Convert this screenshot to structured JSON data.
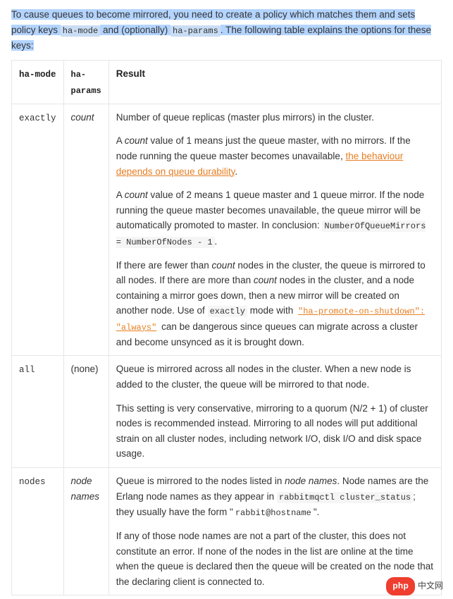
{
  "intro": {
    "seg1": "To cause queues to become mirrored, you need to create a policy which matches them and sets policy keys ",
    "code1": "ha-mode",
    "seg2": " and (optionally) ",
    "code2": "ha-params",
    "seg3": ". The following table explains the options for these keys:"
  },
  "headers": {
    "mode": "ha-mode",
    "params": "ha-params",
    "result": "Result"
  },
  "rows": [
    {
      "mode": "exactly",
      "params": "count",
      "result": {
        "p1": "Number of queue replicas (master plus mirrors) in the cluster.",
        "p2a": "A ",
        "p2em": "count",
        "p2b": " value of 1 means just the queue master, with no mirrors. If the node running the queue master becomes unavailable, ",
        "p2link": "the behaviour depends on queue durability",
        "p2c": ".",
        "p3a": "A ",
        "p3em": "count",
        "p3b": " value of 2 means 1 queue master and 1 queue mirror. If the node running the queue master becomes unavailable, the queue mirror will be automatically promoted to master. In conclusion: ",
        "p3code": "NumberOfQueueMirrors = NumberOfNodes - 1",
        "p3c": ".",
        "p4a": "If there are fewer than ",
        "p4em1": "count",
        "p4b": " nodes in the cluster, the queue is mirrored to all nodes. If there are more than ",
        "p4em2": "count",
        "p4c": " nodes in the cluster, and a node containing a mirror goes down, then a new mirror will be created on another node. Use of ",
        "p4code1": "exactly",
        "p4d": " mode with ",
        "p4link": "\"ha-promote-on-shutdown\": \"always\"",
        "p4e": " can be dangerous since queues can migrate across a cluster and become unsynced as it is brought down."
      }
    },
    {
      "mode": "all",
      "params": "(none)",
      "result": {
        "p1": "Queue is mirrored across all nodes in the cluster. When a new node is added to the cluster, the queue will be mirrored to that node.",
        "p2": "This setting is very conservative, mirroring to a quorum (N/2 + 1) of cluster nodes is recommended instead. Mirroring to all nodes will put additional strain on all cluster nodes, including network I/O, disk I/O and disk space usage."
      }
    },
    {
      "mode": "nodes",
      "params": "node names",
      "result": {
        "p1a": "Queue is mirrored to the nodes listed in ",
        "p1em": "node names",
        "p1b": ". Node names are the Erlang node names as they appear in ",
        "p1code": "rabbitmqctl cluster_status",
        "p1c": "; they usually have the form \"",
        "p1code2": "rabbit@hostname",
        "p1d": "\".",
        "p2": "If any of those node names are not a part of the cluster, this does not constitute an error. If none of the nodes in the list are online at the time when the queue is declared then the queue will be created on the node that the declaring client is connected to."
      }
    }
  ],
  "badge": {
    "php": "php",
    "cn": "中文网"
  }
}
